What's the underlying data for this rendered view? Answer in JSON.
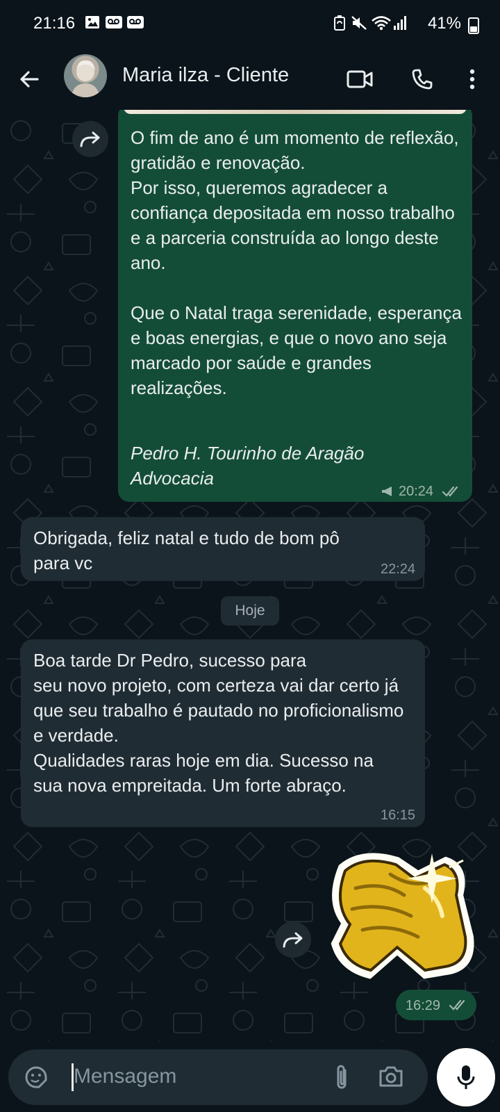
{
  "status_bar": {
    "time": "21:16",
    "battery": "41%",
    "battery_level": 0.41
  },
  "header": {
    "contact_name": "Maria ilza - Cliente"
  },
  "messages": [
    {
      "direction": "outgoing",
      "forwarded": true,
      "text": "O fim de ano é um momento de reflexão, gratidão e renovação.\nPor isso, queremos agradecer a confiança depositada em nosso trabalho e a parceria construída ao longo deste ano.\n\nQue o Natal traga serenidade, esperança e boas energias, e que o novo ano seja marcado por saúde e grandes realizações.",
      "signature": "Pedro H. Tourinho de Aragão\nAdvocacia",
      "time": "20:24",
      "status": "read"
    },
    {
      "direction": "incoming",
      "text": "Obrigada, feliz natal e tudo de bom pô para vc",
      "time": "22:24"
    },
    {
      "direction": "incoming",
      "text": "Boa tarde Dr Pedro, sucesso para\nseu novo projeto, com certeza vai dar certo já que seu trabalho é pautado no proficionalismo e verdade.\nQualidades raras hoje em dia. Sucesso na sua nova empreitada. Um forte abraço.",
      "time": "16:15"
    },
    {
      "direction": "outgoing",
      "type": "sticker",
      "forwarded": true,
      "sticker": "golden-handshake",
      "time": "16:29",
      "status": "read"
    }
  ],
  "date_separator": "Hoje",
  "composer": {
    "placeholder": "Mensagem"
  },
  "colors": {
    "background": "#0b141a",
    "outgoing_bubble": "#144d37",
    "incoming_bubble": "#202c33",
    "read_ticks": "#9fb8ab"
  },
  "icons": [
    "back-arrow-icon",
    "video-call-icon",
    "phone-icon",
    "more-vert-icon",
    "forward-icon",
    "sticker-icon",
    "attach-icon",
    "camera-icon",
    "mic-icon",
    "double-check-icon",
    "broadcast-icon"
  ]
}
